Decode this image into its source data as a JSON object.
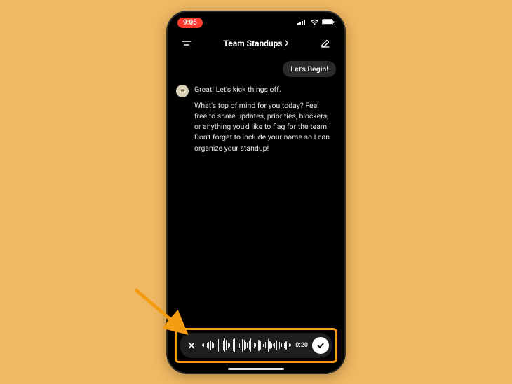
{
  "statusbar": {
    "time": "9:05"
  },
  "navbar": {
    "title": "Team Standups"
  },
  "chat": {
    "user_message": "Let's Begin!",
    "bot_intro": "Great! Let's kick things off.",
    "bot_body": "What's top of mind for you today? Feel free to share updates, priorities, blockers, or anything you'd like to flag for the team. Don't forget to include your name so I can organize your standup!"
  },
  "voice": {
    "timer": "0:20"
  },
  "colors": {
    "highlight": "#f39c12",
    "record_pill": "#ff3b30"
  }
}
